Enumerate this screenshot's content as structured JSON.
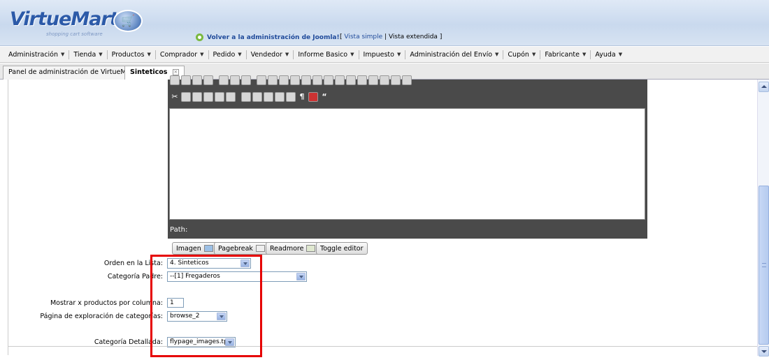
{
  "header": {
    "logo_text": "VirtueMart",
    "logo_sub": "shopping cart software",
    "back_link": "Volver a la administración de Joomla!",
    "view_switch_open": "[",
    "view_simple": "Vista simple",
    "view_sep": "|",
    "view_extended": "Vista extendida",
    "view_switch_close": "]"
  },
  "menu": [
    {
      "label": "Administración"
    },
    {
      "label": "Tienda"
    },
    {
      "label": "Productos"
    },
    {
      "label": "Comprador"
    },
    {
      "label": "Pedido"
    },
    {
      "label": "Vendedor"
    },
    {
      "label": "Informe Basico"
    },
    {
      "label": "Impuesto"
    },
    {
      "label": "Administración del Envío"
    },
    {
      "label": "Cupón"
    },
    {
      "label": "Fabricante"
    },
    {
      "label": "Ayuda"
    }
  ],
  "tabs": {
    "panel": "Panel de administración de VirtueMart",
    "active": "Sinteticos"
  },
  "editor": {
    "path_label": "Path:",
    "buttons": {
      "imagen": "Imagen",
      "pagebreak": "Pagebreak",
      "readmore": "Readmore",
      "toggle": "Toggle editor"
    }
  },
  "form": {
    "orden_label": "Orden en la Lista:",
    "orden_value": "4. Sinteticos",
    "padre_label": "Categoría Padre:",
    "padre_value": "--[1] Fregaderos",
    "mostrar_label": "Mostrar x productos por columna:",
    "mostrar_value": "1",
    "pagina_label": "Página de exploración de categorías:",
    "pagina_value": "browse_2",
    "detallada_label": "Categoría Detallada:",
    "detallada_value": "flypage_images.tpl"
  },
  "colors": {
    "highlight": "#e60000",
    "link": "#1f4a9a",
    "editor_bg": "#4a4a4a"
  }
}
